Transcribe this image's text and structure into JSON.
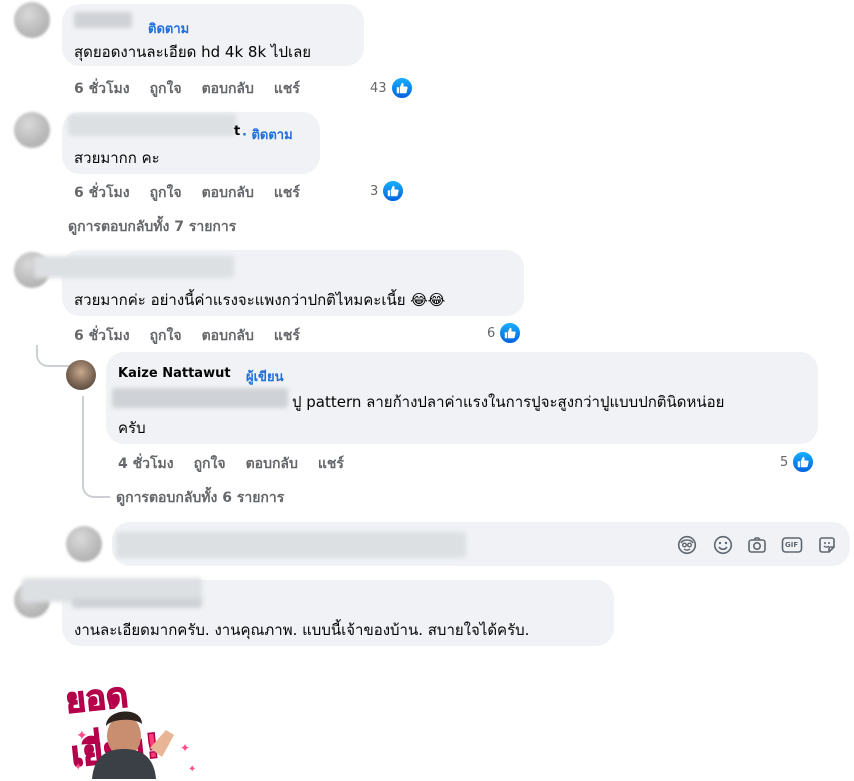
{
  "comments": [
    {
      "follow": "ติดตาม",
      "text": "สุดยอดงานละเอียด hd 4k 8k ไปเลย",
      "time": "6 ชั่วโมง",
      "like": "ถูกใจ",
      "reply": "ตอบกลับ",
      "share": "แชร์",
      "reactions": "43"
    },
    {
      "name_suffix": "t",
      "follow": "ติดตาม",
      "text": "สวยมากก คะ",
      "time": "6 ชั่วโมง",
      "like": "ถูกใจ",
      "reply": "ตอบกลับ",
      "share": "แชร์",
      "reactions": "3",
      "view_replies": "ดูการตอบกลับทั้ง 7 รายการ"
    },
    {
      "text": "สวยมากค่ะ อย่างนี้ค่าแรงจะแพงกว่าปกติไหมคะเนี้ย 😂😂",
      "time": "6 ชั่วโมง",
      "like": "ถูกใจ",
      "reply": "ตอบกลับ",
      "share": "แชร์",
      "reactions": "6"
    }
  ],
  "reply": {
    "name": "Kaize Nattawut",
    "badge": "ผู้เขียน",
    "text_line1": "ปู pattern ลายก้างปลาค่าแรงในการปูจะสูงกว่าปูแบบปกตินิดหน่อย",
    "text_line2": "ครับ",
    "time": "4 ชั่วโมง",
    "like": "ถูกใจ",
    "reply": "ตอบกลับ",
    "share": "แชร์",
    "reactions": "5",
    "view_replies": "ดูการตอบกลับทั้ง 6 รายการ"
  },
  "composer": {
    "icons": [
      "avatar-sticker-icon",
      "emoji-icon",
      "camera-icon",
      "gif-icon",
      "sticker-icon"
    ],
    "gif_label": "GIF"
  },
  "last_comment": {
    "text": "งานละเอียดมากครับ. งานคุณภาพ. แบบนี้เจ้าของบ้าน. สบายใจได้ครับ.",
    "sticker_text": "ยอดเยี่ยม!"
  },
  "colors": {
    "bubble": "#f0f2f5",
    "link": "#216fdb",
    "meta": "#65676b",
    "like": "#0062df"
  }
}
